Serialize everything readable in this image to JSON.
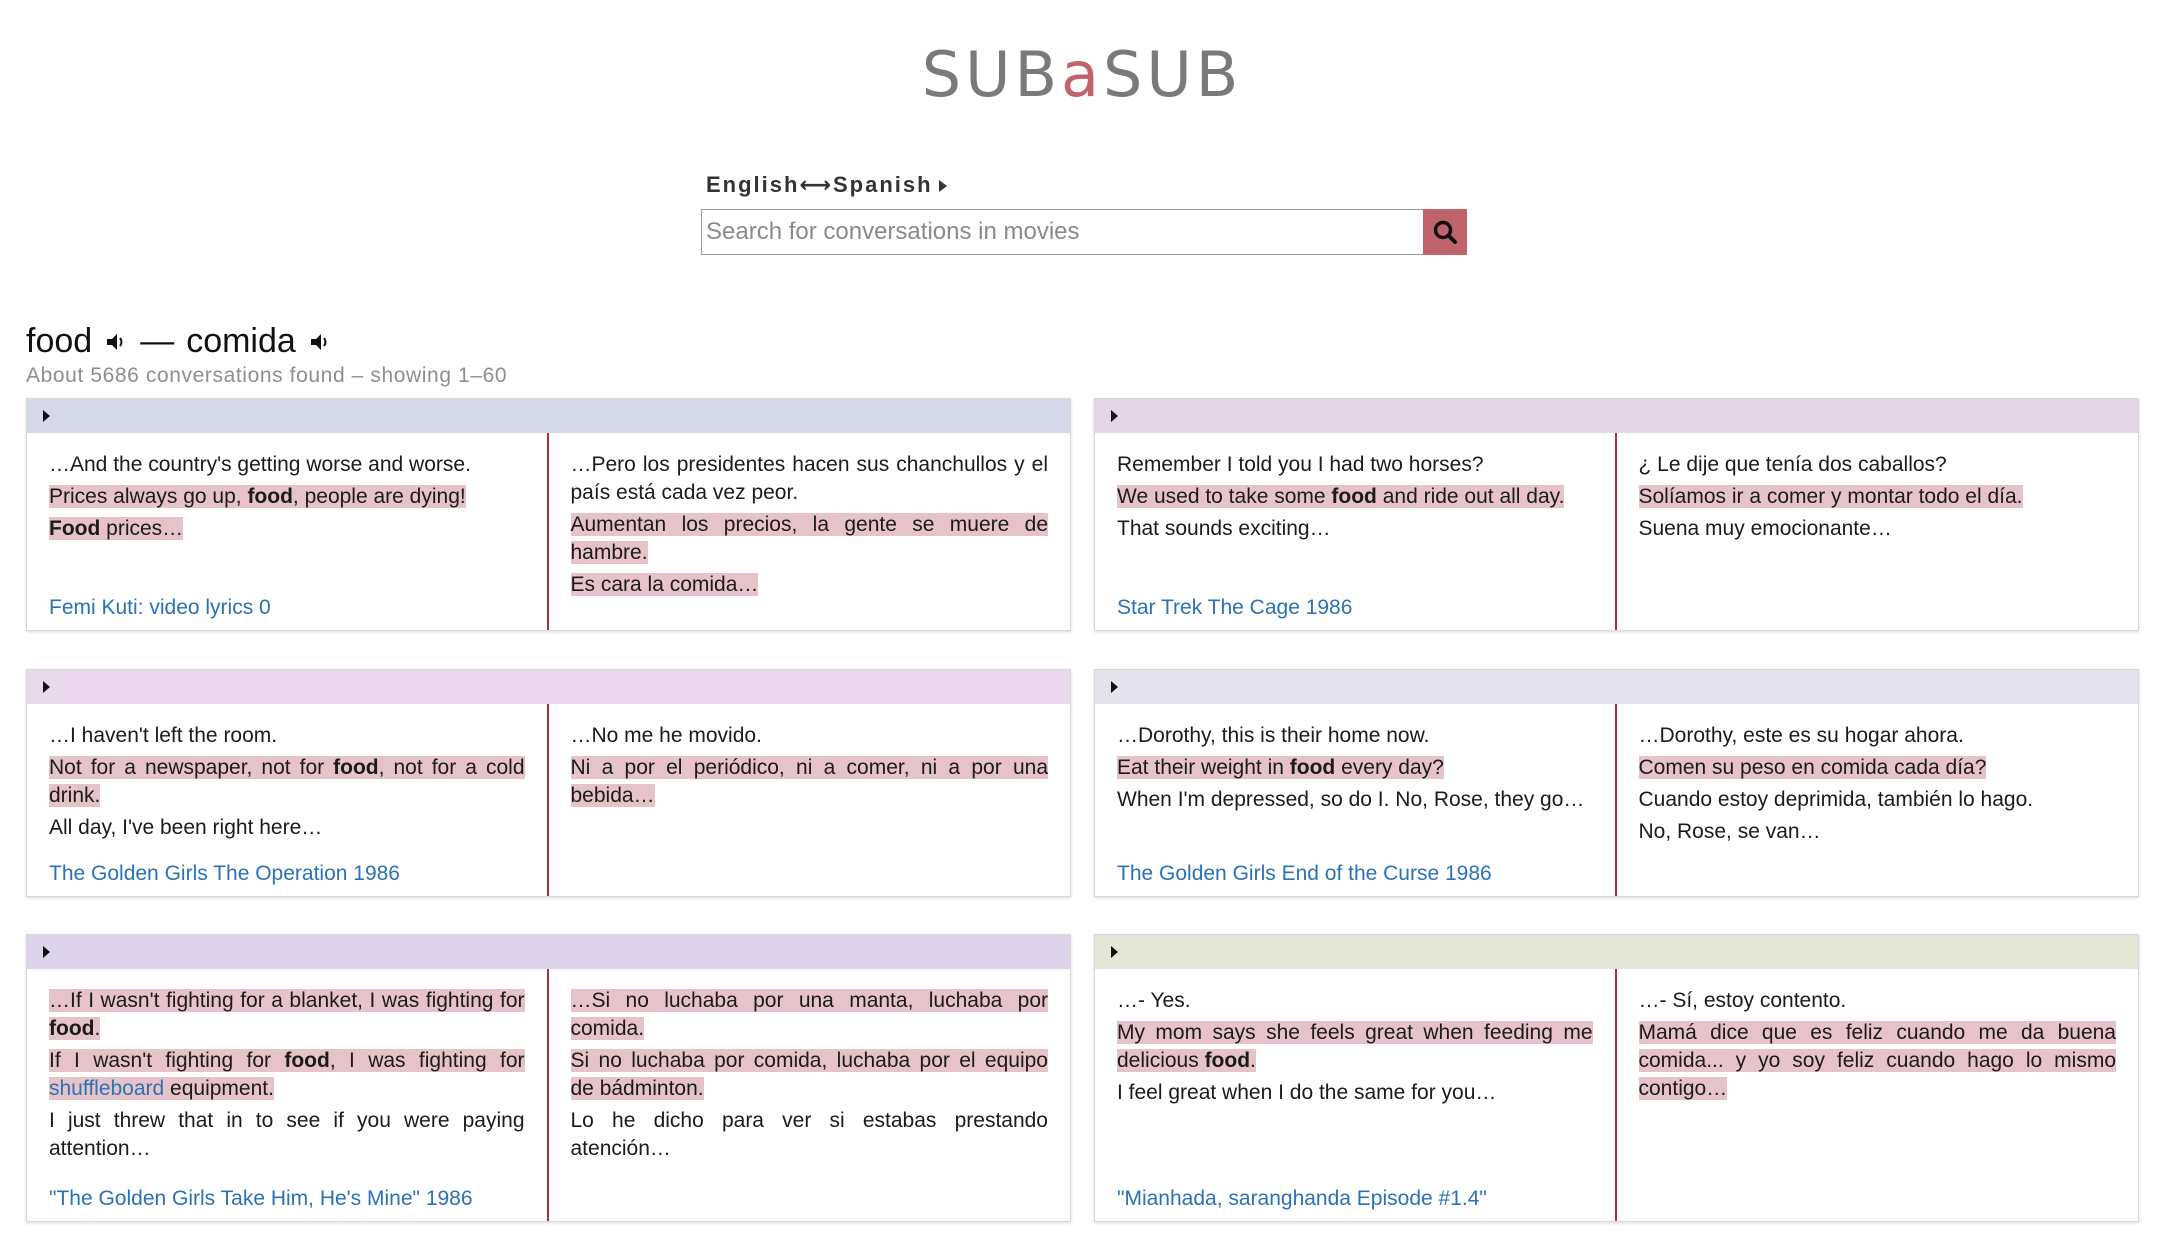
{
  "logo": {
    "left": "SUB",
    "mid": "a",
    "right": "SUB"
  },
  "language_selector": "English⟷Spanish",
  "search": {
    "placeholder": "Search for conversations in movies",
    "value": ""
  },
  "query": {
    "term": "food",
    "separator": "—",
    "translation": "comida"
  },
  "results_summary": "About 5686 conversations found – showing 1–60",
  "colors": {
    "accent": "#c0636c",
    "highlight": "#e6c3c8",
    "link": "#2b72b5",
    "divider": "#a8323c"
  },
  "cards": [
    {
      "header_color": "#d6dae8",
      "source": "Femi Kuti: video lyrics 0",
      "en": [
        "…And the country's getting worse and worse.",
        "Prices always go up, food, people are dying!",
        "Food prices…"
      ],
      "es": [
        "…Pero los presidentes hacen sus chanchullos y el país está cada vez peor.",
        "Aumentan los precios, la gente se muere de hambre.",
        "Es cara la comida…"
      ]
    },
    {
      "header_color": "#e4d6e6",
      "source": "Star Trek The Cage 1986",
      "en": [
        "Remember I told you I had two horses?",
        "We used to take some food and ride out all day.",
        "That sounds exciting…"
      ],
      "es": [
        "¿ Le dije que tenía dos caballos?",
        "Solíamos ir a comer y montar todo el día.",
        "Suena muy emocionante…"
      ]
    },
    {
      "header_color": "#ead9ec",
      "source": "The Golden Girls The Operation 1986",
      "en": [
        "…I haven't left the room.",
        "Not for a newspaper, not for food, not for a cold drink.",
        "All day, I've been right here…"
      ],
      "es": [
        "…No me he movido.",
        "Ni a por el periódico, ni a comer, ni a por una bebida…"
      ]
    },
    {
      "header_color": "#e4e2ec",
      "source": "The Golden Girls End of the Curse 1986",
      "en": [
        "…Dorothy, this is their home now.",
        "Eat their weight in food every day?",
        "When I'm depressed, so do I. No, Rose, they go…"
      ],
      "es": [
        "…Dorothy, este es su hogar ahora.",
        "Comen su peso en comida cada día?",
        "Cuando estoy deprimida, también lo hago.",
        "No, Rose, se van…"
      ]
    },
    {
      "header_color": "#ddd3ea",
      "source": "\"The Golden Girls Take Him, He's Mine\" 1986",
      "en": [
        "…If I wasn't fighting for a blanket, I was fighting for food.",
        "If I wasn't fighting for food, I was fighting for shuffleboard equipment.",
        "I just threw that in to see if you were paying attention…"
      ],
      "es": [
        "…Si no luchaba por una manta, luchaba por comida.",
        "Si no luchaba por comida, luchaba por el equipo de bádminton.",
        "Lo he dicho para ver si estabas prestando atención…"
      ]
    },
    {
      "header_color": "#e4e6d6",
      "source": "\"Mianhada, saranghanda Episode #1.4\"",
      "en": [
        "…- Yes.",
        "My mom says she feels great when feeding me delicious food.",
        "I feel great when I do the same for you…"
      ],
      "es": [
        "…- Sí, estoy contento.",
        "Mamá dice que es feliz cuando me da buena comida... y yo soy feliz cuando hago lo mismo contigo…"
      ]
    }
  ]
}
